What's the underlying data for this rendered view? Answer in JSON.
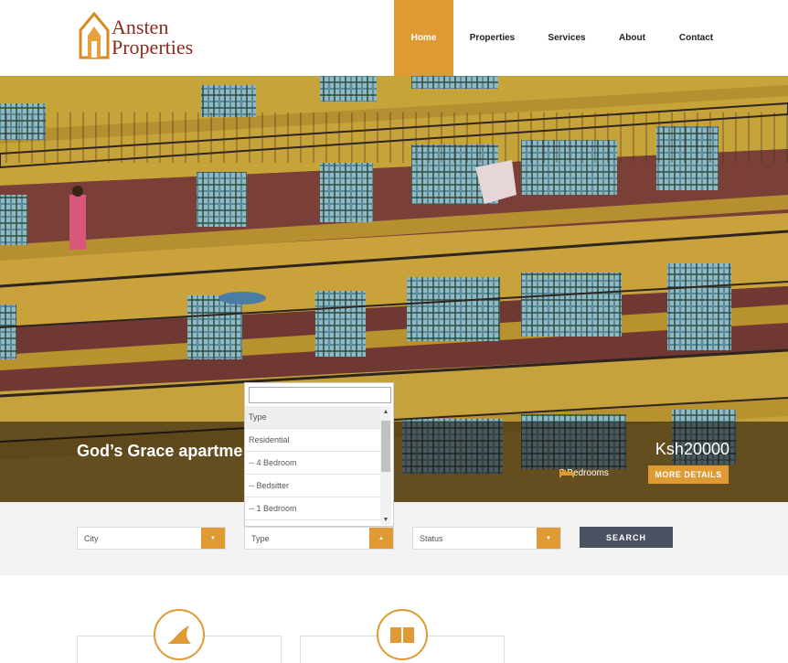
{
  "brand": {
    "line1": "Ansten",
    "line2": "Properties"
  },
  "nav": {
    "items": [
      {
        "label": "Home",
        "active": true
      },
      {
        "label": "Properties"
      },
      {
        "label": "Services"
      },
      {
        "label": "About"
      },
      {
        "label": "Contact"
      }
    ]
  },
  "hero": {
    "title": "God’s Grace apartme",
    "price": "Ksh20000",
    "bedrooms": "2 Bedrooms",
    "more_label": "MORE DETAILS"
  },
  "search": {
    "city": "City",
    "type": "Type",
    "status": "Status",
    "button_label": "SEARCH"
  },
  "type_dropdown": {
    "options": [
      "Type",
      "Residential",
      "-- 4 Bedroom",
      "-- Bedsitter",
      "-- 1 Bedroom"
    ],
    "highlighted": "Type"
  },
  "colors": {
    "accent": "#e09a34",
    "dark_button": "#4a5161",
    "brand_text": "#8b2a1e"
  },
  "icons": {
    "logo": "house-logo-icon",
    "bed": "bed-icon",
    "dropdown_arrow": "caret-icon",
    "feature1": "shark-fin-icon",
    "feature2": "book-icon"
  }
}
